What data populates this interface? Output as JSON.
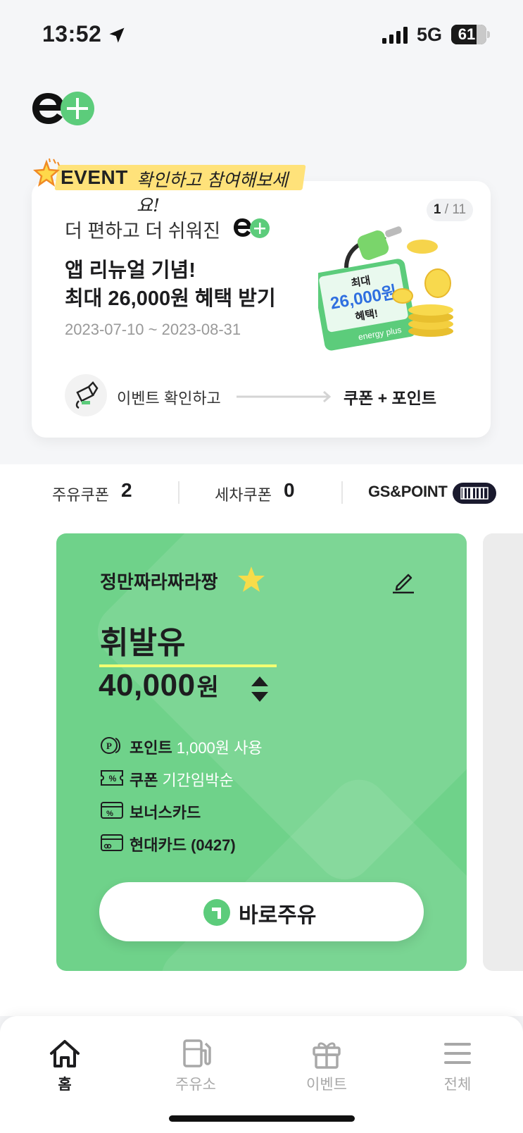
{
  "status": {
    "time": "13:52",
    "network": "5G",
    "battery": "61"
  },
  "event": {
    "ribbon_word": "EVENT",
    "ribbon_text": "확인하고 참여해보세요!",
    "page_current": "1",
    "page_total": "11",
    "line1": "더 편하고 더 쉬워진",
    "title_line1": "앱 리뉴얼 기념!",
    "title_line2": "최대 26,000원 혜택 받기",
    "date": "2023-07-10 ~ 2023-08-31",
    "step1": "이벤트 확인하고",
    "step2": "쿠폰 + 포인트",
    "promo": {
      "top": "최대",
      "amount": "26,000원",
      "bottom": "혜택!",
      "brand": "energy plus"
    }
  },
  "coupons": {
    "fuel_label": "주유쿠폰",
    "fuel_count": "2",
    "wash_label": "세차쿠폰",
    "wash_count": "0",
    "gs_label": "GS&POINT"
  },
  "fuel_card": {
    "name": "정만짜라짜라짱",
    "fuel_type": "휘발유",
    "amount": "40,000",
    "unit": "원",
    "options": [
      {
        "label": "포인트",
        "value": "1,000원 사용",
        "icon": "point-icon"
      },
      {
        "label": "쿠폰",
        "value": "기간임박순",
        "icon": "coupon-icon"
      },
      {
        "label": "보너스카드",
        "value": "",
        "icon": "bonus-card-icon"
      },
      {
        "label": "현대카드 (0427)",
        "value": "",
        "icon": "credit-card-icon"
      }
    ],
    "go_label": "바로주유"
  },
  "tabs": [
    {
      "label": "홈",
      "icon": "home-icon",
      "active": true
    },
    {
      "label": "주유소",
      "icon": "gas-station-icon",
      "active": false
    },
    {
      "label": "이벤트",
      "icon": "gift-icon",
      "active": false
    },
    {
      "label": "전체",
      "icon": "menu-icon",
      "active": false
    }
  ],
  "colors": {
    "brand_green": "#6fd28a",
    "accent_yellow": "#f3ff72",
    "dark": "#1d1d1f"
  }
}
